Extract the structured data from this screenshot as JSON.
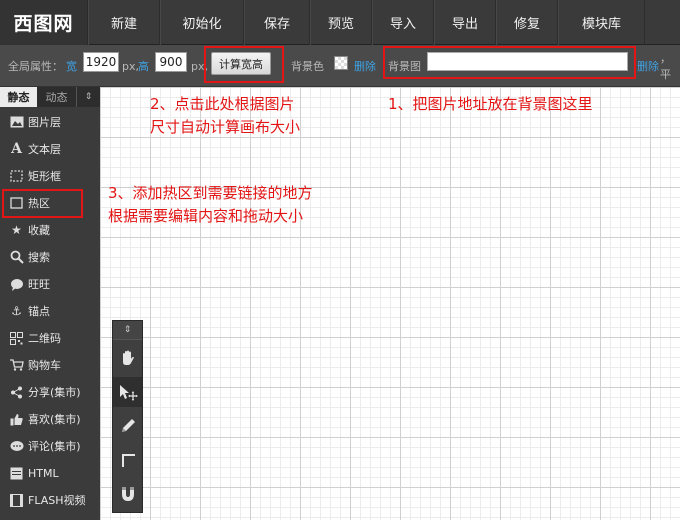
{
  "logo": "西图网",
  "menu": [
    "新建",
    "初始化",
    "保存",
    "预览",
    "导入",
    "导出",
    "修复",
    "模块库"
  ],
  "propbar": {
    "global_label": "全局属性：",
    "width_label": "宽",
    "width_value": "1920",
    "px_unit": "px,",
    "height_label": "高",
    "height_value": "900",
    "calc_button": "计算宽高",
    "bg_color_label": "背景色",
    "delete_label": "删除",
    "bg_image_label": "背景图",
    "bg_image_value": "",
    "delete_label_2": "删除",
    "tail": "，平"
  },
  "sidebar": {
    "tabs": [
      "静态",
      "动态",
      "⇕"
    ],
    "items": [
      {
        "label": "图片层",
        "icon": "image-icon"
      },
      {
        "label": "文本层",
        "icon": "text-icon"
      },
      {
        "label": "矩形框",
        "icon": "dashed-rect-icon"
      },
      {
        "label": "热区",
        "icon": "hotspot-icon"
      },
      {
        "label": "收藏",
        "icon": "star-icon"
      },
      {
        "label": "搜索",
        "icon": "search-icon"
      },
      {
        "label": "旺旺",
        "icon": "chat-bubble-icon"
      },
      {
        "label": "锚点",
        "icon": "anchor-icon"
      },
      {
        "label": "二维码",
        "icon": "qrcode-icon"
      },
      {
        "label": "购物车",
        "icon": "cart-icon"
      },
      {
        "label": "分享(集市)",
        "icon": "share-icon"
      },
      {
        "label": "喜欢(集市)",
        "icon": "thumbs-up-icon"
      },
      {
        "label": "评论(集市)",
        "icon": "comment-icon"
      },
      {
        "label": "HTML",
        "icon": "html-icon"
      },
      {
        "label": "FLASH视频",
        "icon": "video-icon"
      }
    ]
  },
  "annotations": {
    "note1": "1、把图片地址放在背景图这里",
    "note2_line1": "2、点击此处根据图片",
    "note2_line2": "尺寸自动计算画布大小",
    "note3_line1": "3、添加热区到需要链接的地方",
    "note3_line2": "根据需要编辑内容和拖动大小"
  },
  "palette": {
    "collapse": "⇕",
    "tools": [
      "hand-icon",
      "select-move-icon",
      "pencil-icon",
      "crop-corner-icon",
      "magnet-icon"
    ]
  },
  "colors": {
    "annotation_red": "#e31515",
    "link_blue": "#3fa2e6",
    "toolbar_bg": "#3a3a3a"
  }
}
